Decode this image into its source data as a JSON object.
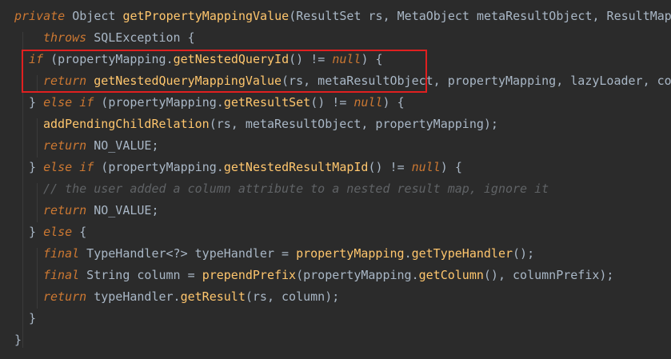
{
  "code_lines": [
    [
      {
        "t": "private",
        "c": "kw"
      },
      {
        "t": " Object ",
        "c": "pl"
      },
      {
        "t": "getPropertyMappingValue",
        "c": "fn"
      },
      {
        "t": "(ResultSet rs, MetaObject metaResultObject, ResultMapp",
        "c": "pl"
      }
    ],
    [
      {
        "t": "throws",
        "c": "kw"
      },
      {
        "t": " SQLException {",
        "c": "pl"
      }
    ],
    [
      {
        "t": "if",
        "c": "kw"
      },
      {
        "t": " (",
        "c": "pl"
      },
      {
        "t": "propertyMapping",
        "c": "pl"
      },
      {
        "t": ".",
        "c": "pl"
      },
      {
        "t": "getNestedQueryId",
        "c": "mth"
      },
      {
        "t": "() != ",
        "c": "pl"
      },
      {
        "t": "null",
        "c": "kw"
      },
      {
        "t": ") {",
        "c": "pl"
      }
    ],
    [
      {
        "t": "return",
        "c": "kw"
      },
      {
        "t": " ",
        "c": "pl"
      },
      {
        "t": "getNestedQueryMappingValue",
        "c": "mth"
      },
      {
        "t": "(rs, metaResultObject, propertyMapping, lazyLoader, col",
        "c": "pl"
      }
    ],
    [
      {
        "t": "} ",
        "c": "pl"
      },
      {
        "t": "else if",
        "c": "kw"
      },
      {
        "t": " (propertyMapping.",
        "c": "pl"
      },
      {
        "t": "getResultSet",
        "c": "mth"
      },
      {
        "t": "() != ",
        "c": "pl"
      },
      {
        "t": "null",
        "c": "kw"
      },
      {
        "t": ") {",
        "c": "pl"
      }
    ],
    [
      {
        "t": "addPendingChildRelation",
        "c": "mth"
      },
      {
        "t": "(rs, metaResultObject, propertyMapping);",
        "c": "pl"
      }
    ],
    [
      {
        "t": "return",
        "c": "kw"
      },
      {
        "t": " NO_VALUE;",
        "c": "pl"
      }
    ],
    [
      {
        "t": "} ",
        "c": "pl"
      },
      {
        "t": "else if",
        "c": "kw"
      },
      {
        "t": " (propertyMapping.",
        "c": "pl"
      },
      {
        "t": "getNestedResultMapId",
        "c": "mth"
      },
      {
        "t": "() != ",
        "c": "pl"
      },
      {
        "t": "null",
        "c": "kw"
      },
      {
        "t": ") {",
        "c": "pl"
      }
    ],
    [
      {
        "t": "// the user added a column attribute to a nested result map, ignore it",
        "c": "cm"
      }
    ],
    [
      {
        "t": "return",
        "c": "kw"
      },
      {
        "t": " NO_VALUE;",
        "c": "pl"
      }
    ],
    [
      {
        "t": "} ",
        "c": "pl"
      },
      {
        "t": "else",
        "c": "kw"
      },
      {
        "t": " {",
        "c": "pl"
      }
    ],
    [
      {
        "t": "final",
        "c": "kw"
      },
      {
        "t": " TypeHandler<?> typeHandler = ",
        "c": "pl"
      },
      {
        "t": "propertyMapping",
        "c": "fn"
      },
      {
        "t": ".",
        "c": "pl"
      },
      {
        "t": "getTypeHandler",
        "c": "mth"
      },
      {
        "t": "();",
        "c": "pl"
      }
    ],
    [
      {
        "t": "final",
        "c": "kw"
      },
      {
        "t": " String column = ",
        "c": "pl"
      },
      {
        "t": "prependPrefix",
        "c": "mth"
      },
      {
        "t": "(propertyMapping.",
        "c": "pl"
      },
      {
        "t": "getColumn",
        "c": "mth"
      },
      {
        "t": "(), columnPrefix);",
        "c": "pl"
      }
    ],
    [
      {
        "t": "return",
        "c": "kw"
      },
      {
        "t": " typeHandler.",
        "c": "pl"
      },
      {
        "t": "getResult",
        "c": "mth"
      },
      {
        "t": "(rs, column);",
        "c": "pl"
      }
    ],
    [
      {
        "t": "}",
        "c": "pl"
      }
    ],
    [
      {
        "t": "}",
        "c": "pl"
      }
    ]
  ],
  "highlight": {
    "color": "#e02020",
    "covers_lines": [
      3,
      4
    ]
  },
  "theme": {
    "background": "#2b2b2b",
    "keyword": "#cc7832",
    "function": "#ffc66d",
    "plain": "#a9b7c6",
    "comment": "#606366"
  }
}
